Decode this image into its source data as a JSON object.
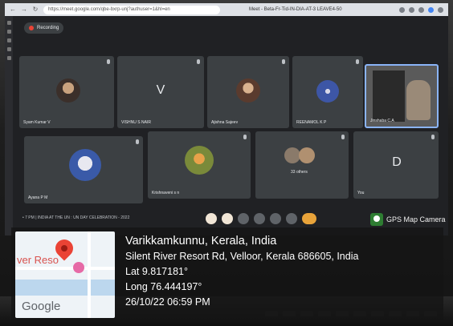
{
  "browser": {
    "url": "https://meet.google.com/qbe-bxrp-unj?authuser=1&hl=en",
    "tab_title": "Meet - Beta-Fr-Tid-IN-DIA-AT-3 LEAVE4-50",
    "nav_back": "←",
    "nav_forward": "→",
    "nav_reload": "↻"
  },
  "meet": {
    "recording_label": "Recording",
    "event_title": "• 7 PM | INDIA AT THE UN : UN DAY CELEBRATION - 2022",
    "participants": [
      {
        "name": "Syam Kumar V",
        "avatar": "photo"
      },
      {
        "letter": "V",
        "name": "VISHNU S NAIR",
        "avatar": "letter"
      },
      {
        "name": "Ajishna Sajeev",
        "avatar": "photo"
      },
      {
        "name": "REENAMOL K P",
        "avatar": "photo"
      },
      {
        "name": "Jinshaba C.A",
        "avatar": "video"
      },
      {
        "name": "Ayana P M",
        "avatar": "photo"
      },
      {
        "name": "Krishnaveni s n",
        "avatar": "photo"
      },
      {
        "name": "33 others",
        "avatar": "group"
      },
      {
        "letter": "D",
        "name": "You",
        "avatar": "letter"
      }
    ]
  },
  "gps_app": {
    "brand": "GPS Map Camera",
    "map_label": "ver Reso",
    "map_logo": "Google",
    "location": "Varikkamkunnu, Kerala, India",
    "address": "Silent River Resort Rd, Velloor, Kerala 686605, India",
    "lat": "Lat 9.817181°",
    "long": "Long 76.444197°",
    "datetime": "26/10/22 06:59 PM"
  },
  "colors": {
    "record_red": "#ea4335",
    "tile_bg": "#3c4043",
    "pin_red": "#ea4335",
    "brand_green": "#2e7d32"
  }
}
